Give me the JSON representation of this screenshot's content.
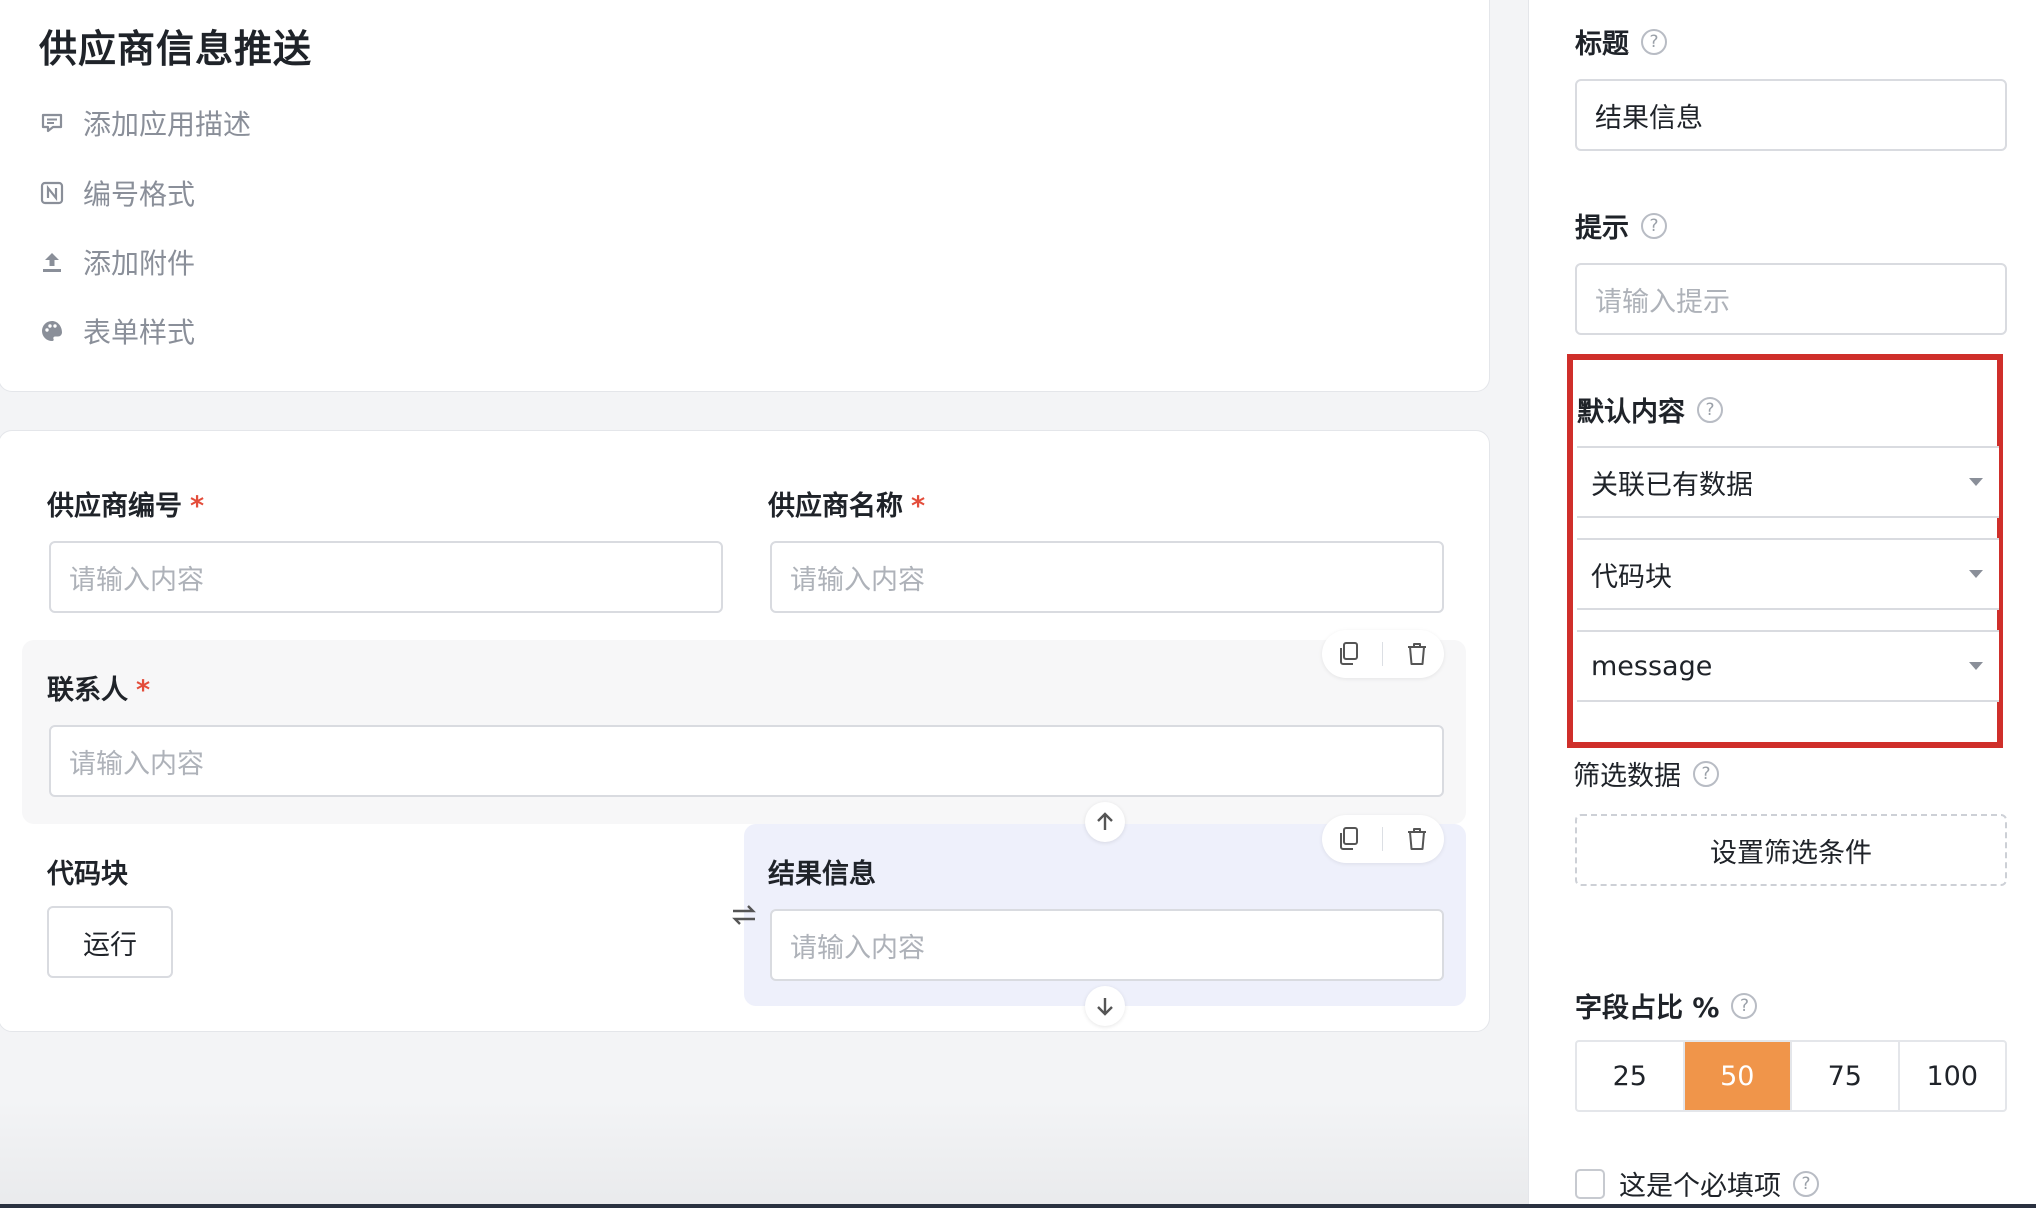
{
  "app": {
    "title": "供应商信息推送",
    "menu": [
      {
        "label": "添加应用描述",
        "icon": "comment-icon"
      },
      {
        "label": "编号格式",
        "icon": "number-format-icon"
      },
      {
        "label": "添加附件",
        "icon": "upload-icon"
      },
      {
        "label": "表单样式",
        "icon": "palette-icon"
      }
    ]
  },
  "form": {
    "supplier_no": {
      "label": "供应商编号",
      "required": "*",
      "placeholder": "请输入内容"
    },
    "supplier_name": {
      "label": "供应商名称",
      "required": "*",
      "placeholder": "请输入内容"
    },
    "contact": {
      "label": "联系人",
      "required": "*",
      "placeholder": "请输入内容"
    },
    "code_block": {
      "label": "代码块",
      "run_label": "运行"
    },
    "result": {
      "label": "结果信息",
      "placeholder": "请输入内容"
    }
  },
  "panel": {
    "title": {
      "label": "标题",
      "value": "结果信息"
    },
    "hint": {
      "label": "提示",
      "placeholder": "请输入提示"
    },
    "default": {
      "label": "默认内容",
      "selects": [
        "关联已有数据",
        "代码块",
        "message"
      ]
    },
    "filter": {
      "label": "筛选数据",
      "button": "设置筛选条件"
    },
    "width": {
      "label": "字段占比 %",
      "options": [
        "25",
        "50",
        "75",
        "100"
      ],
      "selected": "50"
    },
    "required": {
      "label": "这是个必填项"
    },
    "help_glyph": "?"
  },
  "colors": {
    "accent": "#f0954a",
    "highlight": "#cf2f2a",
    "required": "#e34d3b"
  }
}
